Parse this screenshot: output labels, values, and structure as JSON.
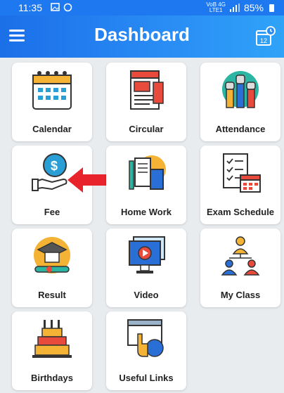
{
  "statusbar": {
    "time": "11:35",
    "network": "VoB 4G",
    "network_sub": "LTE1",
    "battery": "85%"
  },
  "header": {
    "title": "Dashboard"
  },
  "tiles": [
    {
      "label": "Calendar",
      "icon": "calendar-icon"
    },
    {
      "label": "Circular",
      "icon": "circular-icon"
    },
    {
      "label": "Attendance",
      "icon": "attendance-icon"
    },
    {
      "label": "Fee",
      "icon": "fee-icon"
    },
    {
      "label": "Home Work",
      "icon": "homework-icon"
    },
    {
      "label": "Exam Schedule",
      "icon": "exam-schedule-icon"
    },
    {
      "label": "Result",
      "icon": "result-icon"
    },
    {
      "label": "Video",
      "icon": "video-icon"
    },
    {
      "label": "My Class",
      "icon": "my-class-icon"
    },
    {
      "label": "Birthdays",
      "icon": "birthdays-icon"
    },
    {
      "label": "Useful Links",
      "icon": "useful-links-icon"
    }
  ],
  "colors": {
    "header": "#1e78f0",
    "annotation_arrow": "#e8232b"
  }
}
